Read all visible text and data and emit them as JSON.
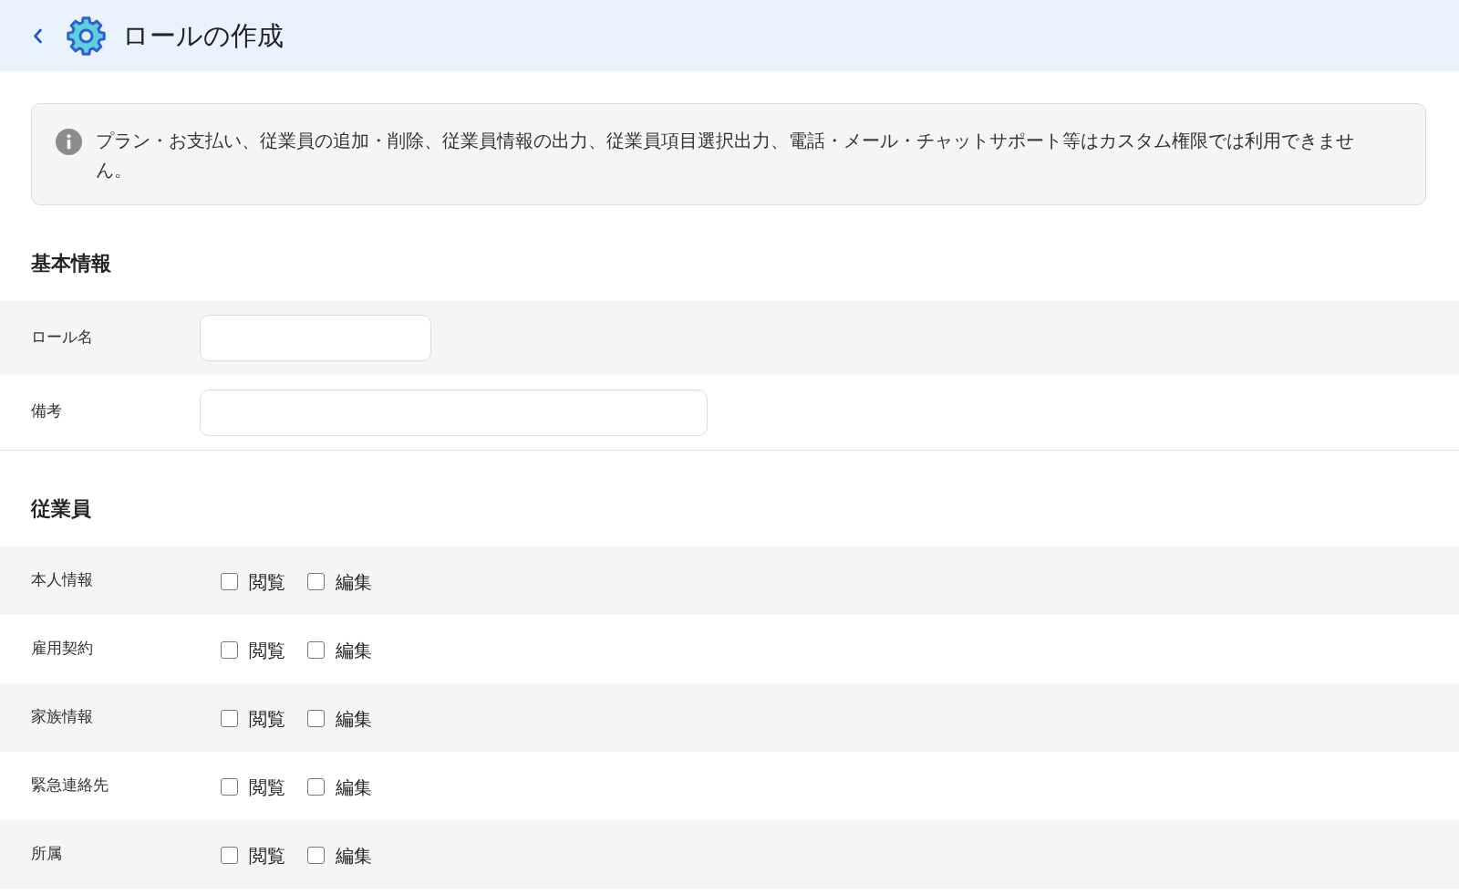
{
  "header": {
    "title": "ロールの作成"
  },
  "notice": {
    "text": "プラン・お支払い、従業員の追加・削除、従業員情報の出力、従業員項目選択出力、電話・メール・チャットサポート等はカスタム権限では利用できません。"
  },
  "sections": [
    {
      "kind": "fields",
      "title": "基本情報",
      "fields": [
        {
          "label": "ロール名"
        },
        {
          "label": "備考"
        }
      ]
    },
    {
      "kind": "permissions",
      "title": "従業員",
      "rows": [
        {
          "label": "本人情報",
          "options": [
            {
              "label": "閲覧",
              "checked": false
            },
            {
              "label": "編集",
              "checked": false
            }
          ]
        },
        {
          "label": "雇用契約",
          "options": [
            {
              "label": "閲覧",
              "checked": false
            },
            {
              "label": "編集",
              "checked": false
            }
          ]
        },
        {
          "label": "家族情報",
          "options": [
            {
              "label": "閲覧",
              "checked": false
            },
            {
              "label": "編集",
              "checked": false
            }
          ]
        },
        {
          "label": "緊急連絡先",
          "options": [
            {
              "label": "閲覧",
              "checked": false
            },
            {
              "label": "編集",
              "checked": false
            }
          ]
        },
        {
          "label": "所属",
          "options": [
            {
              "label": "閲覧",
              "checked": false
            },
            {
              "label": "編集",
              "checked": false
            }
          ]
        }
      ]
    }
  ]
}
